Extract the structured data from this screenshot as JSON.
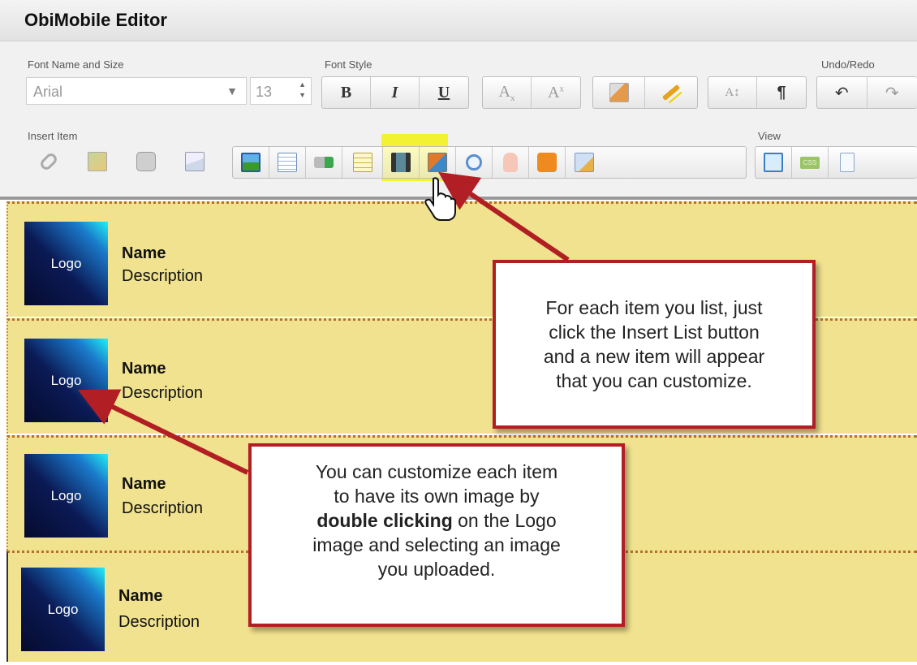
{
  "app": {
    "title": "ObiMobile Editor"
  },
  "toolbar": {
    "font_label": "Font Name and Size",
    "font_name": "Arial",
    "font_size": "13",
    "font_style_label": "Font Style",
    "bold": "B",
    "italic": "I",
    "underline": "U",
    "subscript": "Ax",
    "superscript": "Ax",
    "paragraph": "¶",
    "undo_redo_label": "Undo/Redo",
    "insert_item_label": "Insert Item",
    "view_label": "View",
    "css_badge": "CSS"
  },
  "items": [
    {
      "logo": "Logo",
      "name": "Name",
      "description": "Description"
    },
    {
      "logo": "Logo",
      "name": "Name",
      "description": "Description"
    },
    {
      "logo": "Logo",
      "name": "Name",
      "description": "Description"
    },
    {
      "logo": "Logo",
      "name": "Name",
      "description": "Description"
    }
  ],
  "callouts": {
    "insert_list": [
      "For each item you list, just",
      "click the Insert List button",
      "and a new item will appear",
      "that you can customize."
    ],
    "customize_line1": "You can customize each item",
    "customize_line2": "to have its own image by",
    "customize_bold": "double clicking",
    "customize_line3_rest": " on the Logo",
    "customize_line4": "image and selecting an image",
    "customize_line5": "you uploaded."
  },
  "colors": {
    "callout_border": "#b11e23",
    "row_bg": "#f0e28e",
    "highlight": "#f2f233"
  }
}
